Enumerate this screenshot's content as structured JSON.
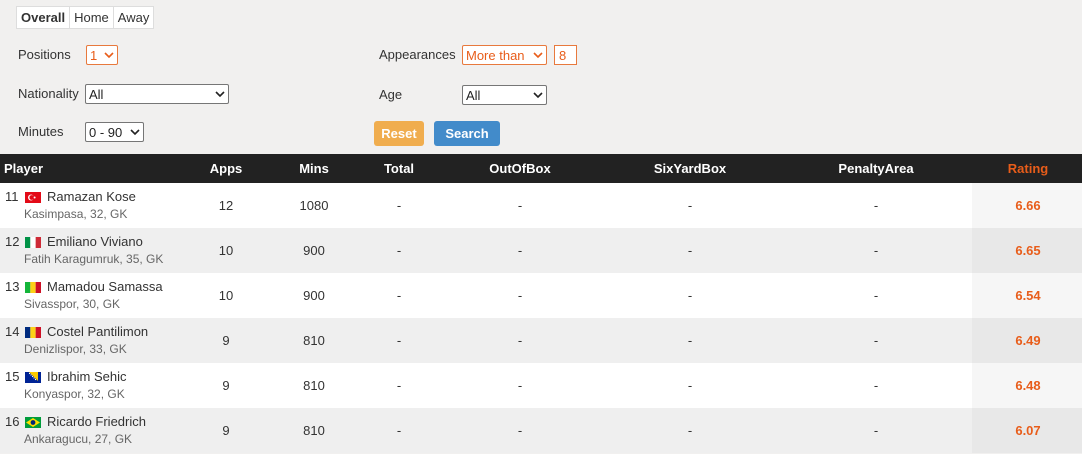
{
  "tabs": [
    {
      "label": "Overall",
      "active": true
    },
    {
      "label": "Home",
      "active": false
    },
    {
      "label": "Away",
      "active": false
    }
  ],
  "filters": {
    "positions_label": "Positions",
    "positions_value": "1",
    "nationality_label": "Nationality",
    "nationality_value": "All",
    "minutes_label": "Minutes",
    "minutes_value": "0 - 90",
    "appearances_label": "Appearances",
    "appearances_mode": "More than",
    "appearances_value": "8",
    "age_label": "Age",
    "age_value": "All",
    "reset_label": "Reset",
    "search_label": "Search"
  },
  "table": {
    "headers": {
      "player": "Player",
      "apps": "Apps",
      "mins": "Mins",
      "total": "Total",
      "outofbox": "OutOfBox",
      "sixyardbox": "SixYardBox",
      "penaltyarea": "PenaltyArea",
      "rating": "Rating"
    },
    "rows": [
      {
        "rank": "11",
        "flag": "turkey-flag-icon",
        "name": "Ramazan Kose",
        "meta": "Kasimpasa,  32, GK",
        "apps": "12",
        "mins": "1080",
        "total": "-",
        "outofbox": "-",
        "sixyardbox": "-",
        "penaltyarea": "-",
        "rating": "6.66"
      },
      {
        "rank": "12",
        "flag": "italy-flag-icon",
        "name": "Emiliano Viviano",
        "meta": "Fatih Karagumruk,  35, GK",
        "apps": "10",
        "mins": "900",
        "total": "-",
        "outofbox": "-",
        "sixyardbox": "-",
        "penaltyarea": "-",
        "rating": "6.65"
      },
      {
        "rank": "13",
        "flag": "mali-flag-icon",
        "name": "Mamadou Samassa",
        "meta": "Sivasspor,  30, GK",
        "apps": "10",
        "mins": "900",
        "total": "-",
        "outofbox": "-",
        "sixyardbox": "-",
        "penaltyarea": "-",
        "rating": "6.54"
      },
      {
        "rank": "14",
        "flag": "romania-flag-icon",
        "name": "Costel Pantilimon",
        "meta": "Denizlispor,  33, GK",
        "apps": "9",
        "mins": "810",
        "total": "-",
        "outofbox": "-",
        "sixyardbox": "-",
        "penaltyarea": "-",
        "rating": "6.49"
      },
      {
        "rank": "15",
        "flag": "bosnia-flag-icon",
        "name": "Ibrahim Sehic",
        "meta": "Konyaspor,  32, GK",
        "apps": "9",
        "mins": "810",
        "total": "-",
        "outofbox": "-",
        "sixyardbox": "-",
        "penaltyarea": "-",
        "rating": "6.48"
      },
      {
        "rank": "16",
        "flag": "brazil-flag-icon",
        "name": "Ricardo Friedrich",
        "meta": "Ankaragucu,  27, GK",
        "apps": "9",
        "mins": "810",
        "total": "-",
        "outofbox": "-",
        "sixyardbox": "-",
        "penaltyarea": "-",
        "rating": "6.07"
      }
    ]
  },
  "colors": {
    "accent": "#e85d1a",
    "header_bg": "#222222",
    "reset_button": "#f0ad4e",
    "search_button": "#428bca"
  }
}
